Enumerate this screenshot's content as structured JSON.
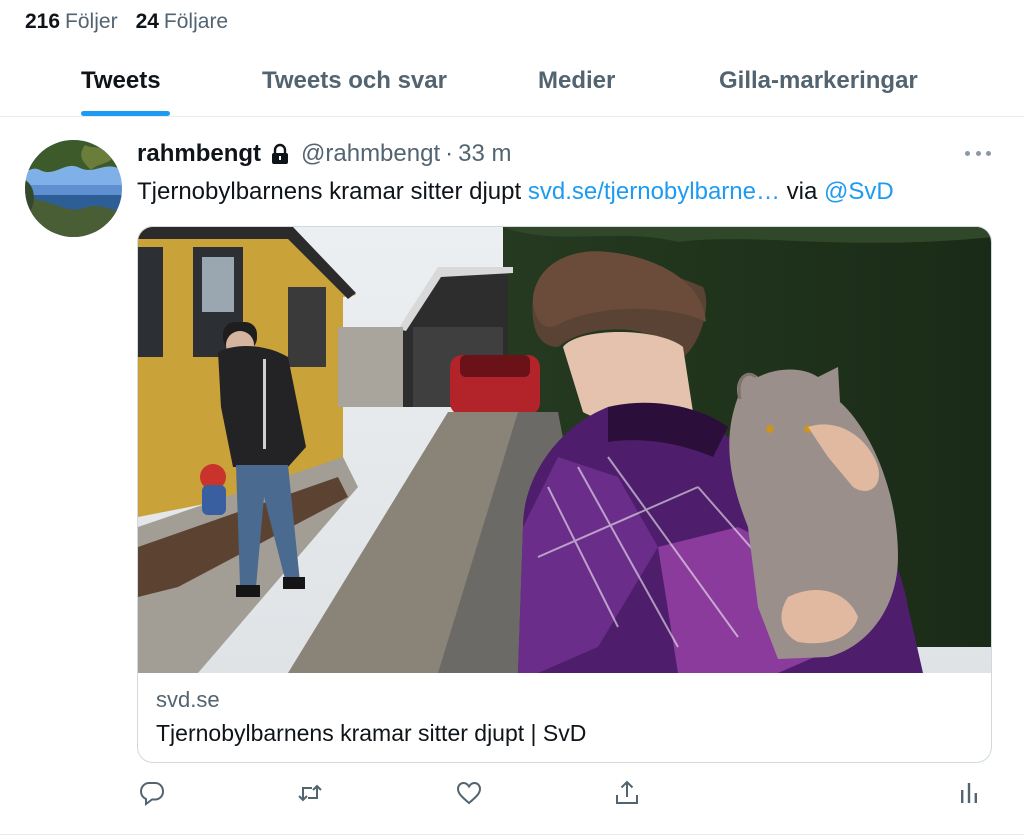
{
  "profile": {
    "following_count": "216",
    "following_label": "Följer",
    "followers_count": "24",
    "followers_label": "Följare"
  },
  "tabs": [
    {
      "label": "Tweets",
      "active": true
    },
    {
      "label": "Tweets och svar",
      "active": false
    },
    {
      "label": "Medier",
      "active": false
    },
    {
      "label": "Gilla-markeringar",
      "active": false
    }
  ],
  "tweet": {
    "display_name": "rahmbengt",
    "handle": "@rahmbengt",
    "separator": "·",
    "time": "33 m",
    "protected_icon": "lock-icon",
    "text_before": "Tjernobylbarnens kramar sitter djupt",
    "link_text": "svd.se/tjernobylbarne…",
    "text_via": "via",
    "mention": "@SvD",
    "card": {
      "domain": "svd.se",
      "title": "Tjernobylbarnens kramar sitter djupt | SvD"
    },
    "actions": [
      "reply-icon",
      "retweet-icon",
      "like-icon",
      "share-icon",
      "analytics-icon"
    ]
  },
  "colors": {
    "accent": "#1d9bf0",
    "secondary_text": "#536471",
    "primary_text": "#0f1419",
    "border": "#cfd9de"
  }
}
